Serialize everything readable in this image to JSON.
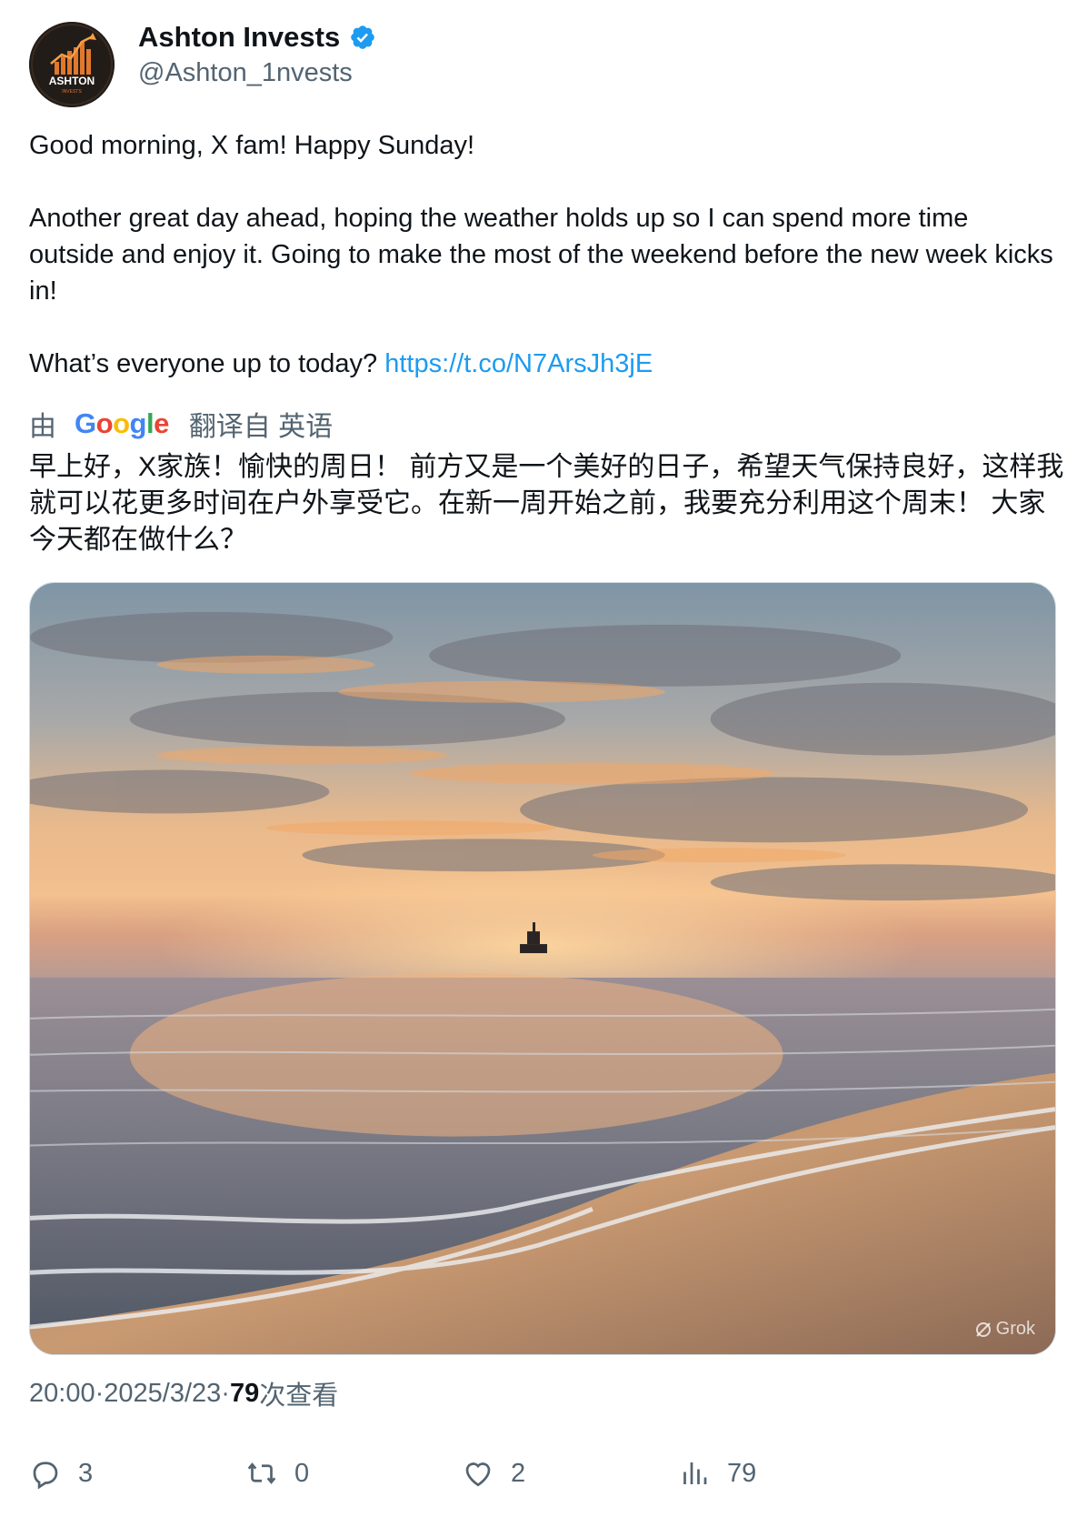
{
  "author": {
    "name": "Ashton Invests",
    "handle": "@Ashton_1nvests",
    "avatar_text": "ASHTON",
    "avatar_subtext": "INVESTS"
  },
  "post": {
    "line1": "Good morning, X fam! Happy Sunday!",
    "line2": "Another great day ahead, hoping the weather holds up so I can spend more time outside and enjoy it. Going to make the most of the weekend before the new week kicks in!",
    "line3": "What’s everyone up to today? ",
    "link": "https://t.co/N7ArsJh3jE"
  },
  "translation": {
    "prefix": "由",
    "google": [
      "G",
      "o",
      "o",
      "g",
      "l",
      "e"
    ],
    "suffix": "翻译自 英语",
    "text": "早上好，X家族！愉快的周日！ 前方又是一个美好的日子，希望天气保持良好，这样我就可以花更多时间在户外享受它。在新一周开始之前，我要充分利用这个周末！ 大家今天都在做什么？"
  },
  "media": {
    "watermark": "Grok"
  },
  "meta": {
    "time": "20:00",
    "sep1": " · ",
    "date": "2025/3/23",
    "sep2": " · ",
    "views": "79",
    "views_label": "次查看"
  },
  "actions": {
    "replies": "3",
    "reposts": "0",
    "likes": "2",
    "views": "79"
  },
  "colors": {
    "accent": "#1d9bf0",
    "secondary_text": "#536471",
    "primary_text": "#0f1419"
  }
}
